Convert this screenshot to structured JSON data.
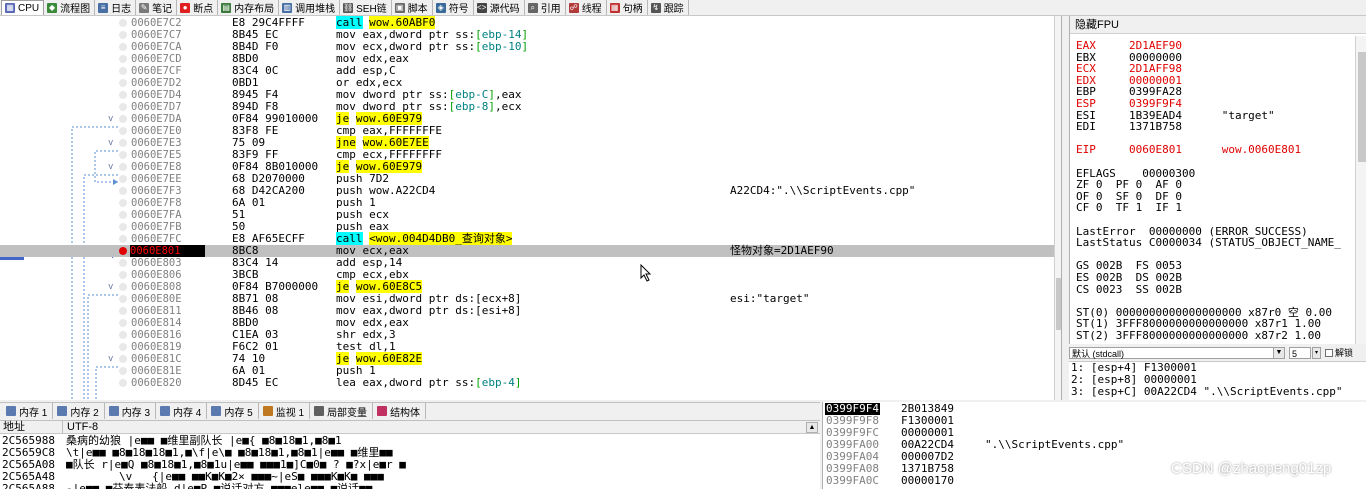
{
  "tabs": [
    {
      "label": "CPU",
      "icon": "cpu-icon",
      "color": "#5a6ab8",
      "glyph": "▦"
    },
    {
      "label": "流程图",
      "icon": "graph-icon",
      "color": "#3a8a3a",
      "glyph": "◆"
    },
    {
      "label": "日志",
      "icon": "log-icon",
      "color": "#4a6fa5",
      "glyph": "≡"
    },
    {
      "label": "笔记",
      "icon": "notes-icon",
      "color": "#7a7a7a",
      "glyph": "✎"
    },
    {
      "label": "断点",
      "icon": "breakpoint-icon",
      "color": "#e02020",
      "glyph": "●"
    },
    {
      "label": "内存布局",
      "icon": "memory-map-icon",
      "color": "#3a7a3a",
      "glyph": "▤"
    },
    {
      "label": "调用堆栈",
      "icon": "callstack-icon",
      "color": "#4a6fa5",
      "glyph": "▥"
    },
    {
      "label": "SEH链",
      "icon": "seh-icon",
      "color": "#555555",
      "glyph": "⛓"
    },
    {
      "label": "脚本",
      "icon": "script-icon",
      "color": "#6a6a6a",
      "glyph": "▣"
    },
    {
      "label": "符号",
      "icon": "symbol-icon",
      "color": "#3a6a9a",
      "glyph": "◈"
    },
    {
      "label": "源代码",
      "icon": "source-icon",
      "color": "#444444",
      "glyph": "<>"
    },
    {
      "label": "引用",
      "icon": "references-icon",
      "color": "#666666",
      "glyph": "⌕"
    },
    {
      "label": "线程",
      "icon": "threads-icon",
      "color": "#b03a3a",
      "glyph": "☍"
    },
    {
      "label": "句柄",
      "icon": "handles-icon",
      "color": "#c03030",
      "glyph": "▦"
    },
    {
      "label": "跟踪",
      "icon": "trace-icon",
      "color": "#555555",
      "glyph": "↯"
    }
  ],
  "disasm": {
    "eip_label": "EIP",
    "rows": [
      {
        "addr": "0060E7C2",
        "bytes": "E8 29C4FFFF",
        "arr": "",
        "asm": [
          {
            "t": "call",
            "c": "ch"
          },
          {
            "t": " "
          },
          {
            "t": "wow.60ABF0",
            "c": "jh"
          }
        ],
        "cmt": ""
      },
      {
        "addr": "0060E7C7",
        "bytes": "8B45 EC",
        "arr": "",
        "asm": [
          {
            "t": "mov eax,dword ptr ss:"
          },
          {
            "t": "[",
            "c": "brk"
          },
          {
            "t": "ebp-14",
            "c": "disp"
          },
          {
            "t": "]",
            "c": "brk"
          }
        ],
        "cmt": ""
      },
      {
        "addr": "0060E7CA",
        "bytes": "8B4D F0",
        "arr": "",
        "asm": [
          {
            "t": "mov ecx,dword ptr ss:"
          },
          {
            "t": "[",
            "c": "brk"
          },
          {
            "t": "ebp-10",
            "c": "disp"
          },
          {
            "t": "]",
            "c": "brk"
          }
        ],
        "cmt": ""
      },
      {
        "addr": "0060E7CD",
        "bytes": "8BD0",
        "arr": "",
        "asm": [
          {
            "t": "mov edx,eax"
          }
        ],
        "cmt": ""
      },
      {
        "addr": "0060E7CF",
        "bytes": "83C4 0C",
        "arr": "",
        "asm": [
          {
            "t": "add esp,C"
          }
        ],
        "cmt": ""
      },
      {
        "addr": "0060E7D2",
        "bytes": "0BD1",
        "arr": "",
        "asm": [
          {
            "t": "or edx,ecx"
          }
        ],
        "cmt": ""
      },
      {
        "addr": "0060E7D4",
        "bytes": "8945 F4",
        "arr": "",
        "asm": [
          {
            "t": "mov dword ptr ss:"
          },
          {
            "t": "[",
            "c": "brk"
          },
          {
            "t": "ebp-C",
            "c": "disp"
          },
          {
            "t": "]",
            "c": "brk"
          },
          {
            "t": ",eax"
          }
        ],
        "cmt": ""
      },
      {
        "addr": "0060E7D7",
        "bytes": "894D F8",
        "arr": "",
        "asm": [
          {
            "t": "mov dword ptr ss:"
          },
          {
            "t": "[",
            "c": "brk"
          },
          {
            "t": "ebp-8",
            "c": "disp"
          },
          {
            "t": "]",
            "c": "brk"
          },
          {
            "t": ",ecx"
          }
        ],
        "cmt": ""
      },
      {
        "addr": "0060E7DA",
        "bytes": "0F84 99010000",
        "arr": "v",
        "asm": [
          {
            "t": "je",
            "c": "jh"
          },
          {
            "t": " "
          },
          {
            "t": "wow.60E979",
            "c": "jh"
          }
        ],
        "cmt": ""
      },
      {
        "addr": "0060E7E0",
        "bytes": "83F8 FE",
        "arr": "",
        "asm": [
          {
            "t": "cmp eax,FFFFFFFE"
          }
        ],
        "cmt": ""
      },
      {
        "addr": "0060E7E3",
        "bytes": "75 09",
        "arr": "v",
        "asm": [
          {
            "t": "jne",
            "c": "jh"
          },
          {
            "t": " "
          },
          {
            "t": "wow.60E7EE",
            "c": "jh"
          }
        ],
        "cmt": ""
      },
      {
        "addr": "0060E7E5",
        "bytes": "83F9 FF",
        "arr": "",
        "asm": [
          {
            "t": "cmp ecx,FFFFFFFF"
          }
        ],
        "cmt": ""
      },
      {
        "addr": "0060E7E8",
        "bytes": "0F84 8B010000",
        "arr": "v",
        "asm": [
          {
            "t": "je",
            "c": "jh"
          },
          {
            "t": " "
          },
          {
            "t": "wow.60E979",
            "c": "jh"
          }
        ],
        "cmt": ""
      },
      {
        "addr": "0060E7EE",
        "bytes": "68 D2070000",
        "arr": "",
        "asm": [
          {
            "t": "push 7D2"
          }
        ],
        "cmt": ""
      },
      {
        "addr": "0060E7F3",
        "bytes": "68 D42CA200",
        "arr": "",
        "asm": [
          {
            "t": "push wow.A22CD4"
          }
        ],
        "cmt": "A22CD4:\".\\\\ScriptEvents.cpp\""
      },
      {
        "addr": "0060E7F8",
        "bytes": "6A 01",
        "arr": "",
        "asm": [
          {
            "t": "push 1"
          }
        ],
        "cmt": ""
      },
      {
        "addr": "0060E7FA",
        "bytes": "51",
        "arr": "",
        "asm": [
          {
            "t": "push ecx"
          }
        ],
        "cmt": ""
      },
      {
        "addr": "0060E7FB",
        "bytes": "50",
        "arr": "",
        "asm": [
          {
            "t": "push eax"
          }
        ],
        "cmt": ""
      },
      {
        "addr": "0060E7FC",
        "bytes": "E8 AF65ECFF",
        "arr": "",
        "asm": [
          {
            "t": "call",
            "c": "ch"
          },
          {
            "t": " "
          },
          {
            "t": "<wow.004D4DB0_查询对象>",
            "c": "jh"
          }
        ],
        "cmt": ""
      },
      {
        "addr": "0060E801",
        "bytes": "8BC8",
        "arr": "",
        "eip": true,
        "asm": [
          {
            "t": "mov ecx,eax"
          }
        ],
        "cmt": "怪物对象=2D1AEF90"
      },
      {
        "addr": "0060E803",
        "bytes": "83C4 14",
        "arr": "",
        "asm": [
          {
            "t": "add esp,14"
          }
        ],
        "cmt": ""
      },
      {
        "addr": "0060E806",
        "bytes": "3BCB",
        "arr": "",
        "asm": [
          {
            "t": "cmp ecx,ebx"
          }
        ],
        "cmt": ""
      },
      {
        "addr": "0060E808",
        "bytes": "0F84 B7000000",
        "arr": "v",
        "asm": [
          {
            "t": "je",
            "c": "jh"
          },
          {
            "t": " "
          },
          {
            "t": "wow.60E8C5",
            "c": "jh"
          }
        ],
        "cmt": ""
      },
      {
        "addr": "0060E80E",
        "bytes": "8B71 08",
        "arr": "",
        "asm": [
          {
            "t": "mov esi,dword ptr ds:[ecx+8]"
          }
        ],
        "cmt": "esi:\"target\""
      },
      {
        "addr": "0060E811",
        "bytes": "8B46 08",
        "arr": "",
        "asm": [
          {
            "t": "mov eax,dword ptr ds:[esi+8]"
          }
        ],
        "cmt": ""
      },
      {
        "addr": "0060E814",
        "bytes": "8BD0",
        "arr": "",
        "asm": [
          {
            "t": "mov edx,eax"
          }
        ],
        "cmt": ""
      },
      {
        "addr": "0060E816",
        "bytes": "C1EA 03",
        "arr": "",
        "asm": [
          {
            "t": "shr edx,3"
          }
        ],
        "cmt": ""
      },
      {
        "addr": "0060E819",
        "bytes": "F6C2 01",
        "arr": "",
        "asm": [
          {
            "t": "test dl,1"
          }
        ],
        "cmt": ""
      },
      {
        "addr": "0060E81C",
        "bytes": "74 10",
        "arr": "v",
        "asm": [
          {
            "t": "je",
            "c": "jh"
          },
          {
            "t": " "
          },
          {
            "t": "wow.60E82E",
            "c": "jh"
          }
        ],
        "cmt": ""
      },
      {
        "addr": "0060E81E",
        "bytes": "6A 01",
        "arr": "",
        "asm": [
          {
            "t": "push 1"
          }
        ],
        "cmt": ""
      },
      {
        "addr": "0060E820",
        "bytes": "8D45 EC",
        "arr": "",
        "asm": [
          {
            "t": "lea eax,dword ptr ss:"
          },
          {
            "t": "[",
            "c": "brk"
          },
          {
            "t": "ebp-4",
            "c": "disp"
          },
          {
            "t": "]",
            "c": "brk"
          }
        ],
        "cmt": ""
      }
    ]
  },
  "registers": {
    "header": "隐藏FPU",
    "lines": [
      {
        "t": "EAX     2D1AEF90",
        "red": true
      },
      {
        "t": "EBX     00000000"
      },
      {
        "t": "ECX     2D1AFF98",
        "red": true
      },
      {
        "t": "EDX     00000001",
        "red": true
      },
      {
        "t": "EBP     0399FA28"
      },
      {
        "t": "ESP     0399F9F4",
        "red": true
      },
      {
        "t": "ESI     1B39EAD4      \"target\""
      },
      {
        "t": "EDI     1371B758"
      },
      {
        "t": ""
      },
      {
        "t": "EIP     0060E801      wow.0060E801",
        "red": true
      },
      {
        "t": ""
      },
      {
        "t": "EFLAGS    00000300"
      },
      {
        "t": "ZF 0  PF 0  AF 0"
      },
      {
        "t": "OF 0  SF 0  DF 0"
      },
      {
        "t": "CF 0  TF 1  IF 1"
      },
      {
        "t": ""
      },
      {
        "t": "LastError  00000000 (ERROR_SUCCESS)"
      },
      {
        "t": "LastStatus C0000034 (STATUS_OBJECT_NAME_"
      },
      {
        "t": ""
      },
      {
        "t": "GS 002B  FS 0053"
      },
      {
        "t": "ES 002B  DS 002B"
      },
      {
        "t": "CS 0023  SS 002B"
      },
      {
        "t": ""
      },
      {
        "t": "ST(0) 0000000000000000000 x87r0 空 0.00"
      },
      {
        "t": "ST(1) 3FFF8000000000000000 x87r1 1.00"
      },
      {
        "t": "ST(2) 3FFF8000000000000000 x87r2 1.00"
      }
    ]
  },
  "callconv": {
    "value": "默认 (stdcall)",
    "count": "5",
    "unlock_label": "解锁"
  },
  "stack_args": [
    "1: [esp+4] F1300001",
    "2: [esp+8] 00000001",
    "3: [esp+C] 00A22CD4 \".\\\\ScriptEvents.cpp\""
  ],
  "bottom_tabs": [
    {
      "label": "内存 1",
      "icon": "memory-icon"
    },
    {
      "label": "内存 2",
      "icon": "memory-icon"
    },
    {
      "label": "内存 3",
      "icon": "memory-icon"
    },
    {
      "label": "内存 4",
      "icon": "memory-icon"
    },
    {
      "label": "内存 5",
      "icon": "memory-icon"
    },
    {
      "label": "监视 1",
      "icon": "watch-icon"
    },
    {
      "label": "局部变量",
      "icon": "locals-icon"
    },
    {
      "label": "结构体",
      "icon": "struct-icon"
    }
  ],
  "dump": {
    "col_addr": "地址",
    "col_text": "UTF-8",
    "rows": [
      {
        "addr": "2C565988",
        "text": "桑病的幼狼 |e■■ ■维里副队长 |e■{ ■8■18■1,■8■1"
      },
      {
        "addr": "2C5659C8",
        "text": "\\t|e■■ ■8■18■18■1,■\\f|e\\■ ■8■18■1,■8■1|e■■ ■维里■■"
      },
      {
        "addr": "2C565A08",
        "text": "■队长 r|e■Q ■8■18■1,■8■1u|e■■ ■■■1■]C■0■ ? ■?x|e■r ■"
      },
      {
        "addr": "2C565A48",
        "text": "        \\v   {|e■■ ■■K■K■2× ■■■~|eS■ ■■■K■K■ ■■■"
      },
      {
        "addr": "2C565A88",
        "text": "-|e■■ ■芬泰表法船 d|e■P ■说话对方 ■■■ele■■ ■说话■■"
      }
    ]
  },
  "stack": {
    "rows": [
      {
        "addr": "0399F9F4",
        "val": "2B013849",
        "cmt": "",
        "top": true
      },
      {
        "addr": "0399F9F8",
        "val": "F1300001",
        "cmt": ""
      },
      {
        "addr": "0399F9FC",
        "val": "00000001",
        "cmt": ""
      },
      {
        "addr": "0399FA00",
        "val": "00A22CD4",
        "cmt": "\".\\\\ScriptEvents.cpp\""
      },
      {
        "addr": "0399FA04",
        "val": "000007D2",
        "cmt": ""
      },
      {
        "addr": "0399FA08",
        "val": "1371B758",
        "cmt": ""
      },
      {
        "addr": "0399FA0C",
        "val": "00000170",
        "cmt": ""
      }
    ]
  },
  "watermark": "CSDN @zhaopeng01zp"
}
